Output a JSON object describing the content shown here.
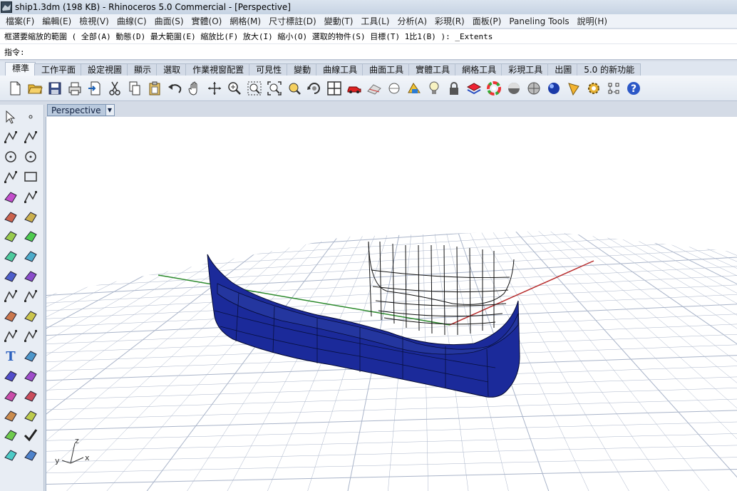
{
  "window": {
    "title": "ship1.3dm (198 KB) - Rhinoceros 5.0 Commercial - [Perspective]"
  },
  "menu": [
    "檔案(F)",
    "編輯(E)",
    "檢視(V)",
    "曲線(C)",
    "曲面(S)",
    "實體(O)",
    "網格(M)",
    "尺寸標註(D)",
    "變動(T)",
    "工具(L)",
    "分析(A)",
    "彩現(R)",
    "面板(P)",
    "Paneling Tools",
    "說明(H)"
  ],
  "command": {
    "prompt": "框選要縮放的範圍 ( 全部(A)  動態(D)  最大範圍(E)  縮放比(F)  放大(I)  縮小(O)  選取的物件(S)  目標(T)  1比1(B) ): _Extents",
    "label": "指令:",
    "value": ""
  },
  "tabs": [
    "標準",
    "工作平面",
    "設定視圖",
    "顯示",
    "選取",
    "作業視窗配置",
    "可見性",
    "變動",
    "曲線工具",
    "曲面工具",
    "實體工具",
    "網格工具",
    "彩現工具",
    "出圖",
    "5.0 的新功能"
  ],
  "active_tab": "標準",
  "toolbar_icons": [
    "new-file-icon",
    "open-folder-icon",
    "save-icon",
    "print-icon",
    "import-icon",
    "cut-icon",
    "copy-icon",
    "paste-icon",
    "undo-icon",
    "pan-hand-icon",
    "rotate-view-icon",
    "zoom-icon",
    "zoom-window-icon",
    "zoom-extents-icon",
    "zoom-selected-icon",
    "rotate-camera-icon",
    "four-viewports-icon",
    "car-icon",
    "hide-icon",
    "show-icon",
    "select-points-icon",
    "light-bulb-icon",
    "lock-icon",
    "layers-icon",
    "color-wheel-icon",
    "render-sphere-icon",
    "shaded-sphere-icon",
    "blue-sphere-icon",
    "pencil-icon",
    "gear-icon",
    "grip-icon",
    "help-icon"
  ],
  "viewport": {
    "name": "Perspective",
    "axes": {
      "x": "x",
      "y": "y",
      "z": "z"
    }
  },
  "colors": {
    "hull": "#1b2a9a",
    "grid": "#a9b4c9",
    "x_axis": "#b82c2c",
    "y_axis": "#2c8a2c",
    "accent": "#8da6c7"
  }
}
